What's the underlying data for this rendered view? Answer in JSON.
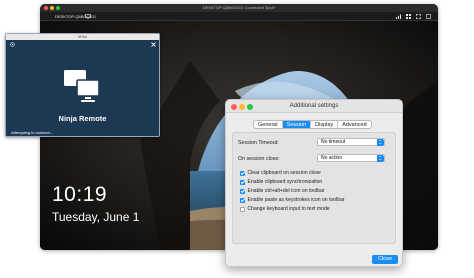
{
  "remote": {
    "window_title": "DESKTOP-Q8BOOGG Connected 3pc4*",
    "device_name": "DESKTOP-Q8BOOGG",
    "lock_time": "10:19",
    "lock_date": "Tuesday, June 1"
  },
  "ninja": {
    "window_title": "NPilot",
    "app_name": "Ninja Remote",
    "status": "Attempting to connect..."
  },
  "settings": {
    "title": "Additional settings",
    "tabs": [
      {
        "label": "General",
        "active": false
      },
      {
        "label": "Session",
        "active": true
      },
      {
        "label": "Display",
        "active": false
      },
      {
        "label": "Advanced",
        "active": false
      }
    ],
    "session_timeout_label": "Session Timeout:",
    "session_timeout_value": "No timeout",
    "on_session_close_label": "On session close:",
    "on_session_close_value": "No action",
    "options": [
      {
        "label": "Clear clipboard on session close",
        "checked": true
      },
      {
        "label": "Enable clipboard synchronization",
        "checked": true
      },
      {
        "label": "Enable ctrl+alt+del icon on toolbar",
        "checked": true
      },
      {
        "label": "Enable paste as keystrokes icon on toolbar",
        "checked": true
      },
      {
        "label": "Change keyboard input to text mode",
        "checked": false
      }
    ],
    "close_label": "Close"
  },
  "colors": {
    "accent": "#1b8df2",
    "ninja_bg": "#1d3852",
    "sky_top": "#7fa9cf",
    "sea": "#3b6f94"
  },
  "icons": [
    "monitor-icon",
    "network-icon",
    "grid-icon",
    "expand-icon",
    "fullscreen-icon",
    "close-icon",
    "ninja-logo-icon"
  ]
}
